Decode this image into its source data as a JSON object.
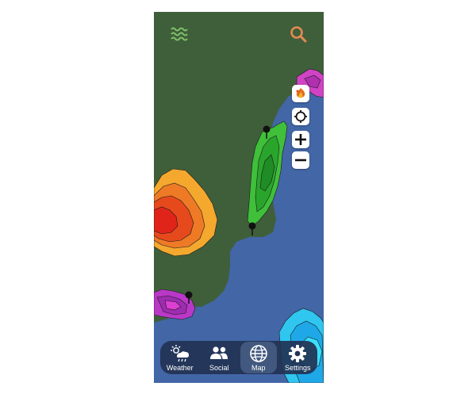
{
  "app": {
    "colors": {
      "land": "#3f5f3a",
      "water": "#4266a6",
      "tabbar": "#223254",
      "accent_search": "#e38a52",
      "accent_menu": "#7fc06a"
    },
    "icons": {
      "menu": "waves-menu-icon",
      "search": "search-icon",
      "layer": "wildfire-layer-icon",
      "locate": "locate-icon",
      "zoom_in": "zoom-in-icon",
      "zoom_out": "zoom-out-icon"
    }
  },
  "map": {
    "overlay_colors": {
      "heat": [
        "#f4a82e",
        "#ee7a26",
        "#e64a1c",
        "#e0241a"
      ],
      "green": [
        "#3fbf3a",
        "#2aa52c",
        "#1f8c25"
      ],
      "magenta": [
        "#ba38c8",
        "#9e2cb0",
        "#de3fd2"
      ],
      "cyan": [
        "#2fc6f0",
        "#1fa8e8",
        "#38e0ff"
      ],
      "pink": [
        "#d043c4",
        "#b030b0"
      ]
    }
  },
  "tabs": [
    {
      "id": "weather",
      "label": "Weather",
      "icon": "weather-icon",
      "active": false
    },
    {
      "id": "social",
      "label": "Social",
      "icon": "people-icon",
      "active": false
    },
    {
      "id": "map",
      "label": "Map",
      "icon": "globe-icon",
      "active": true
    },
    {
      "id": "settings",
      "label": "Settings",
      "icon": "gear-icon",
      "active": false
    }
  ]
}
